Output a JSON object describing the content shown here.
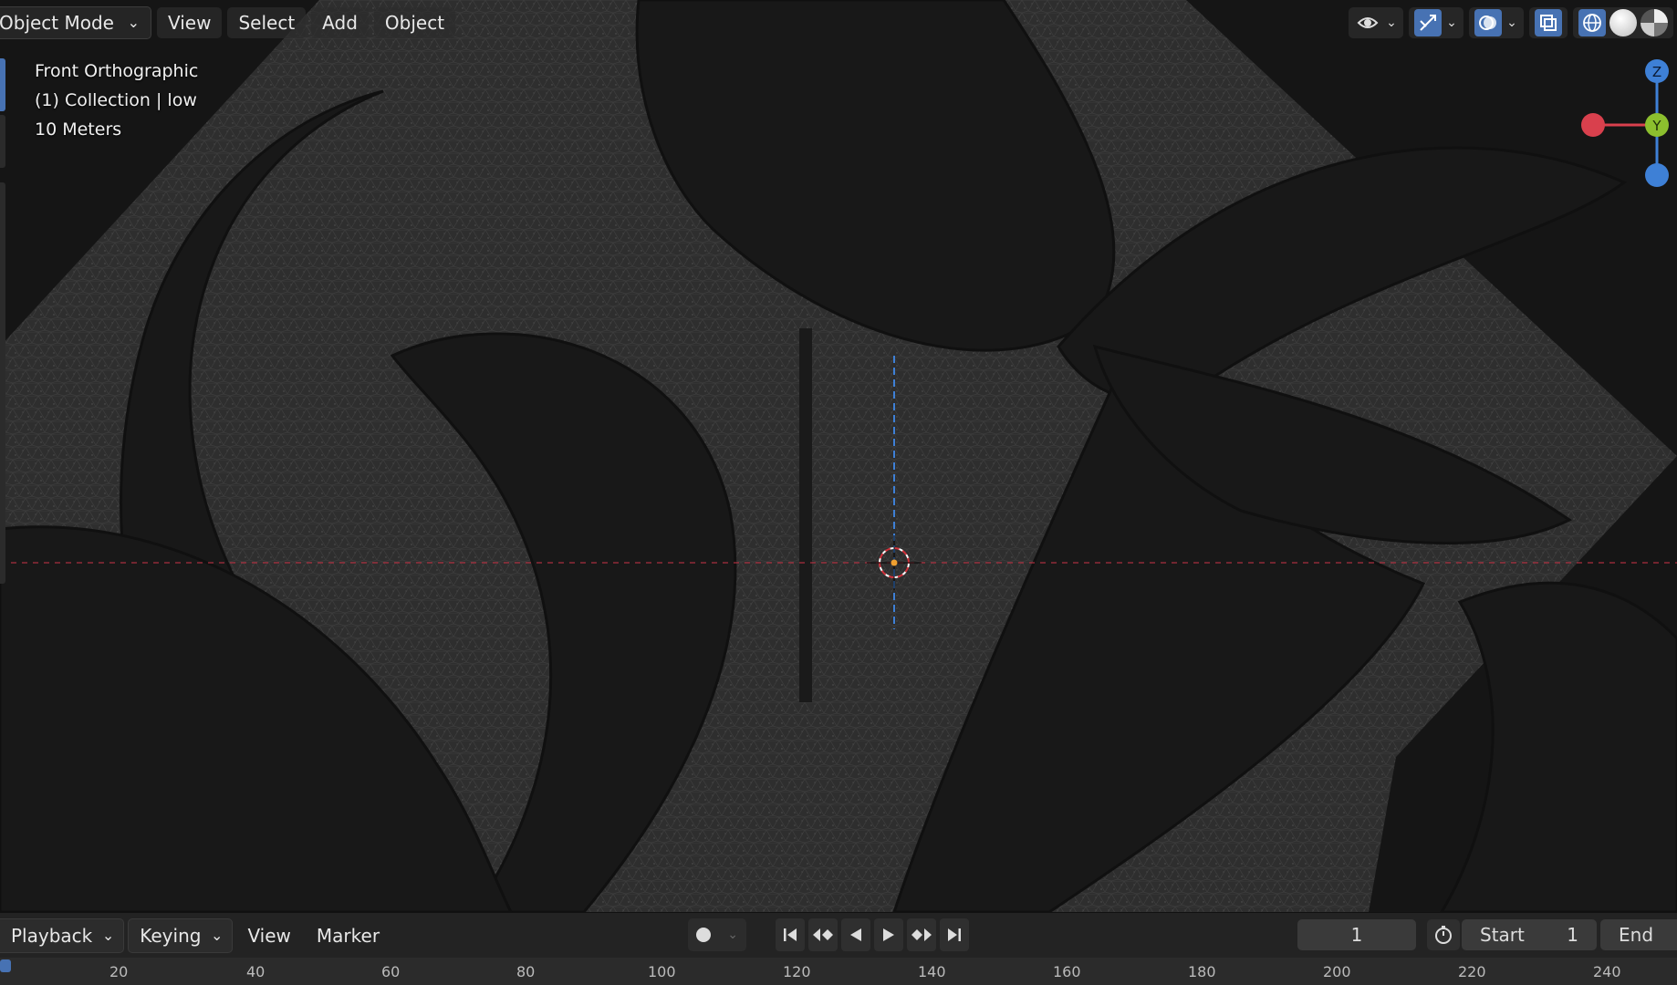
{
  "header": {
    "mode": "Object Mode",
    "menus": [
      "View",
      "Select",
      "Add",
      "Object"
    ],
    "icons": [
      "eye-icon",
      "gizmo-icon",
      "overlay-icon",
      "xray-icon",
      "wireframe-shading-icon",
      "solid-shading-icon",
      "material-shading-icon"
    ]
  },
  "viewport": {
    "view_name": "Front Orthographic",
    "collection": "(1) Collection | low",
    "scale": "10 Meters"
  },
  "gizmo": {
    "z": "Z",
    "y": "Y",
    "colors": {
      "x": "#d9404d",
      "y": "#8cbf2e",
      "z": "#3e80d6"
    }
  },
  "timeline": {
    "menus": [
      "Playback",
      "Keying",
      "View",
      "Marker"
    ],
    "current_frame": "1",
    "start_label": "Start",
    "start_value": "1",
    "end_label": "End",
    "ruler_ticks": [
      "20",
      "40",
      "60",
      "80",
      "100",
      "120",
      "140",
      "160",
      "180",
      "200",
      "220",
      "240"
    ]
  },
  "colors": {
    "accent": "#4772b3",
    "background": "#151515"
  }
}
